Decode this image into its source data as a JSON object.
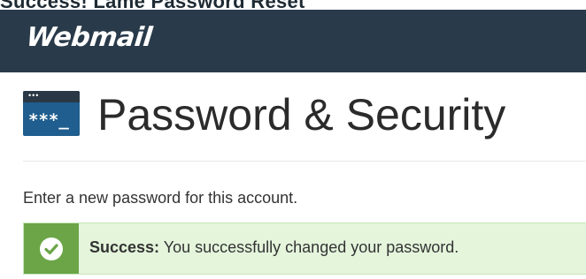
{
  "top_strip_text": "Success! Lame Password Reset",
  "header": {
    "brand": "Webmail",
    "background": "#293a4a"
  },
  "page": {
    "icon": {
      "name": "password-terminal-icon",
      "dots": "•••",
      "glyph": "***_"
    },
    "title": "Password & Security",
    "instructions": "Enter a new password for this account."
  },
  "alert": {
    "icon": "check-circle-icon",
    "strong": "Success:",
    "message": "You successfully changed your password.",
    "color": "#6ba547"
  }
}
